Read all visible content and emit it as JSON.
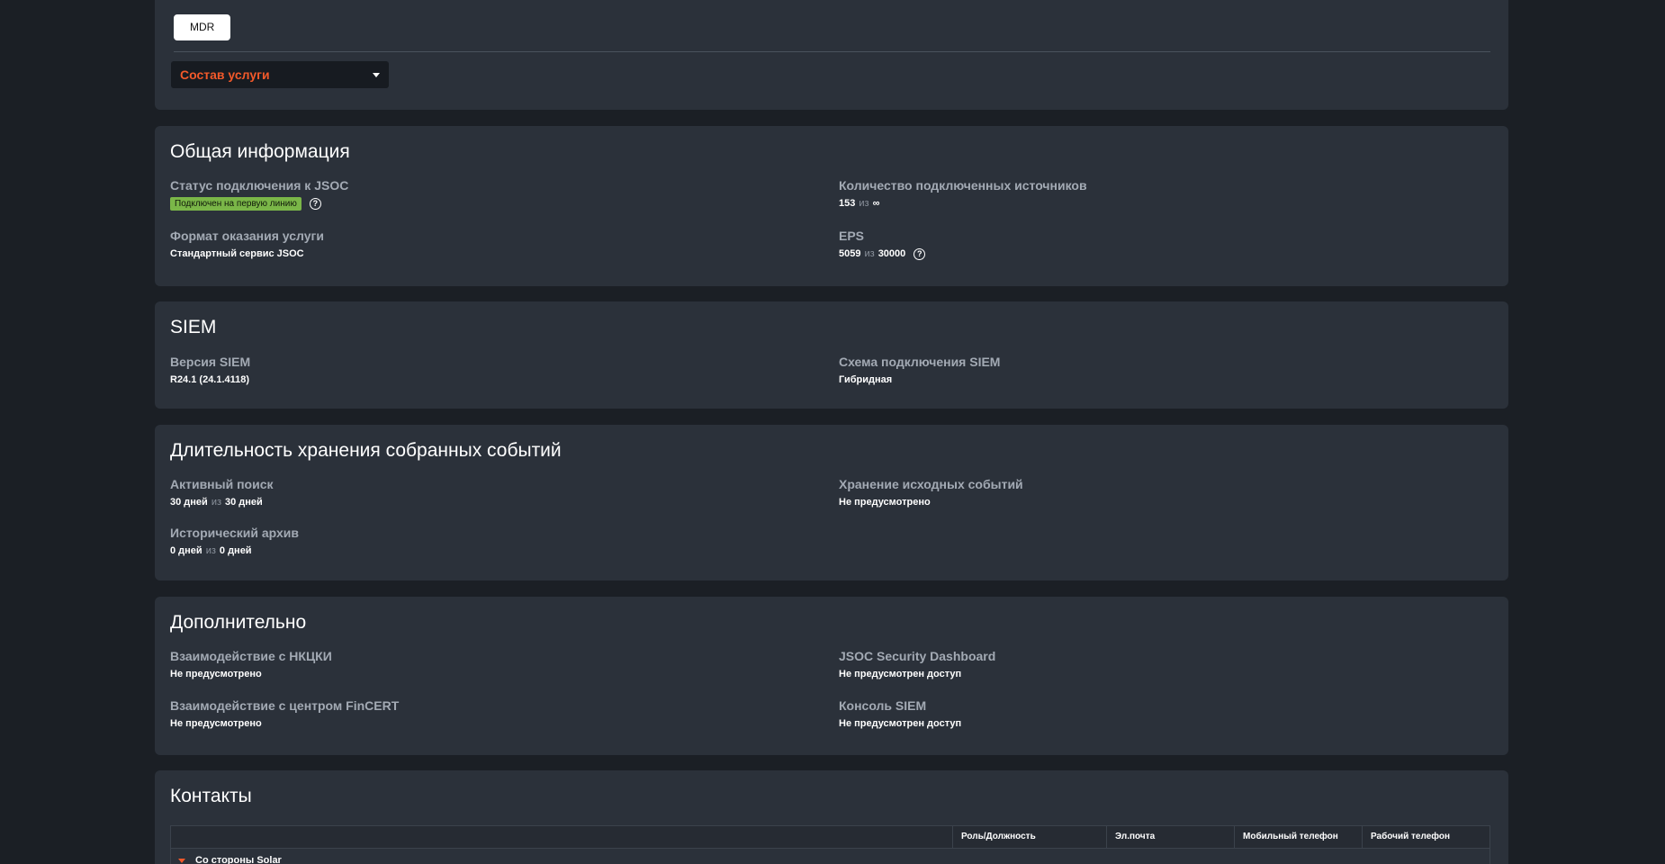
{
  "top": {
    "tab_label": "MDR",
    "select_value": "Состав услуги"
  },
  "general": {
    "title": "Общая информация",
    "status_label": "Статус подключения к JSOC",
    "status_badge": "Подключен на первую линию",
    "sources_label": "Количество подключенных источников",
    "sources_value": "153",
    "sources_of": "из",
    "sources_total": "∞",
    "format_label": "Формат оказания услуги",
    "format_value": "Стандартный сервис JSOC",
    "eps_label": "EPS",
    "eps_value": "5059",
    "eps_of": "из",
    "eps_total": "30000"
  },
  "siem": {
    "title": "SIEM",
    "version_label": "Версия SIEM",
    "version_value": "R24.1 (24.1.4118)",
    "scheme_label": "Схема подключения SIEM",
    "scheme_value": "Гибридная"
  },
  "retention": {
    "title": "Длительность хранения собранных событий",
    "active_label": "Активный поиск",
    "active_value": "30 дней",
    "active_of": "из",
    "active_total": "30 дней",
    "raw_label": "Хранение исходных событий",
    "raw_value": "Не предусмотрено",
    "archive_label": "Исторический архив",
    "archive_value": "0 дней",
    "archive_of": "из",
    "archive_total": "0 дней"
  },
  "extra": {
    "title": "Дополнительно",
    "nkcki_label": "Взаимодействие с НКЦКИ",
    "nkcki_value": "Не предусмотрено",
    "dashboard_label": "JSOC Security Dashboard",
    "dashboard_value": "Не предусмотрен доступ",
    "fincert_label": "Взаимодействие с центром FinCERT",
    "fincert_value": "Не предусмотрено",
    "console_label": "Консоль SIEM",
    "console_value": "Не предусмотрен доступ"
  },
  "contacts": {
    "title": "Контакты",
    "columns": [
      "",
      "Роль/Должность",
      "Эл.почта",
      "Мобильный телефон",
      "Рабочий телефон"
    ],
    "group_label": "Со стороны Solar"
  },
  "colors": {
    "accent": "#f2592a",
    "badge_green": "#7ab648",
    "card_bg": "#2b313a",
    "page_bg": "#1b1f25"
  }
}
